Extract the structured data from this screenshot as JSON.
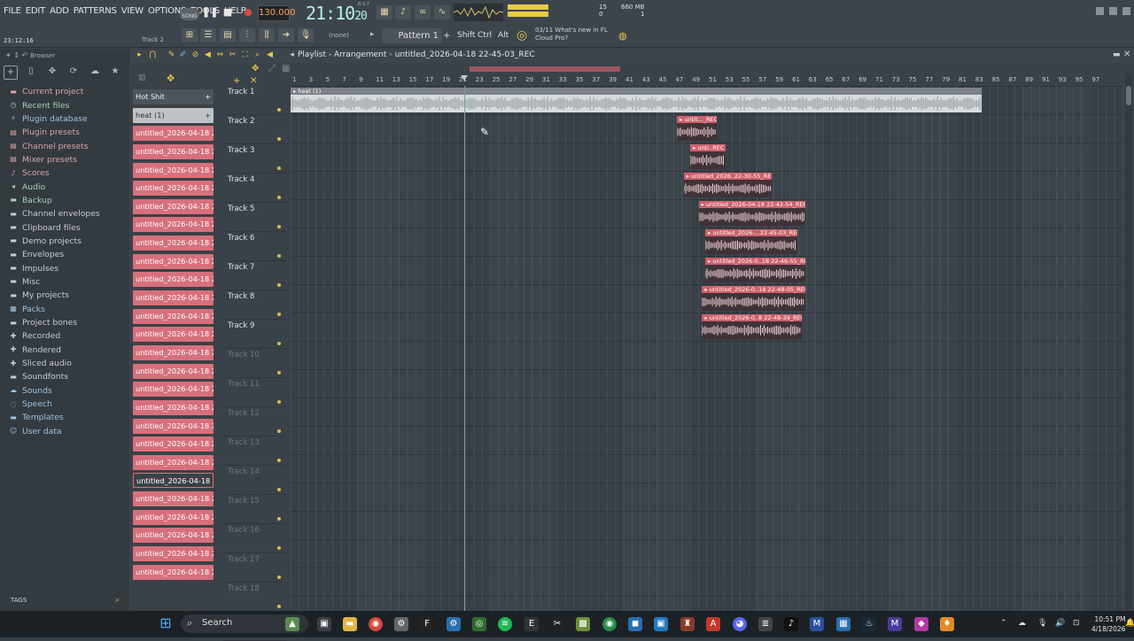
{
  "menu": [
    "FILE",
    "EDIT",
    "ADD",
    "PATTERNS",
    "VIEW",
    "OPTIONS",
    "TOOLS",
    "HELP"
  ],
  "transport": {
    "mode": "SONG",
    "tempo": "130.000",
    "clock": "21:10",
    "clock_small": "20",
    "clock_unit": "B:S:T"
  },
  "status": {
    "memory": "660 MB",
    "memory_sub": "1",
    "polyphony": "15",
    "polyphony_sub": "0"
  },
  "hint": {
    "time": "23:12:16",
    "track": "Track 2"
  },
  "pattern": {
    "none_label": "(none)",
    "pattern_label": "Pattern 1",
    "shift": "Shift",
    "ctrl": "Ctrl",
    "alt": "Alt"
  },
  "news": {
    "line1": "03/11  What's new in FL",
    "line2": "Cloud Pro?"
  },
  "browser": {
    "title": "Browser",
    "items": [
      {
        "label": "Current project",
        "color": "#d9a5aa",
        "icon": "folder-icon"
      },
      {
        "label": "Recent files",
        "color": "#a9d1b8",
        "icon": "clock-icon"
      },
      {
        "label": "Plugin database",
        "color": "#9fc3e0",
        "icon": "plug-icon"
      },
      {
        "label": "Plugin presets",
        "color": "#d9a5aa",
        "icon": "preset-icon"
      },
      {
        "label": "Channel presets",
        "color": "#d9a5aa",
        "icon": "preset-icon"
      },
      {
        "label": "Mixer presets",
        "color": "#d9a5aa",
        "icon": "preset-icon"
      },
      {
        "label": "Scores",
        "color": "#d9a5aa",
        "icon": "note-icon"
      },
      {
        "label": "Audio",
        "color": "#a9d1b8",
        "icon": "speaker-icon"
      },
      {
        "label": "Backup",
        "color": "#a9d1b8",
        "icon": "folder-icon"
      },
      {
        "label": "Channel envelopes",
        "color": "#c8ccd0",
        "icon": "folder-icon"
      },
      {
        "label": "Clipboard files",
        "color": "#c8ccd0",
        "icon": "folder-icon"
      },
      {
        "label": "Demo projects",
        "color": "#c8ccd0",
        "icon": "folder-icon"
      },
      {
        "label": "Envelopes",
        "color": "#c8ccd0",
        "icon": "folder-icon"
      },
      {
        "label": "Impulses",
        "color": "#c8ccd0",
        "icon": "folder-icon"
      },
      {
        "label": "Misc",
        "color": "#c8ccd0",
        "icon": "folder-icon"
      },
      {
        "label": "My projects",
        "color": "#c8ccd0",
        "icon": "folder-icon"
      },
      {
        "label": "Packs",
        "color": "#9fc3e0",
        "icon": "pack-icon"
      },
      {
        "label": "Project bones",
        "color": "#c8ccd0",
        "icon": "folder-icon"
      },
      {
        "label": "Recorded",
        "color": "#c8ccd0",
        "icon": "plus-icon"
      },
      {
        "label": "Rendered",
        "color": "#c8ccd0",
        "icon": "plus-icon"
      },
      {
        "label": "Sliced audio",
        "color": "#c8ccd0",
        "icon": "plus-icon"
      },
      {
        "label": "Soundfonts",
        "color": "#c8ccd0",
        "icon": "folder-icon"
      },
      {
        "label": "Sounds",
        "color": "#9fc3e0",
        "icon": "cloud-icon"
      },
      {
        "label": "Speech",
        "color": "#9fc3e0",
        "icon": "speech-icon"
      },
      {
        "label": "Templates",
        "color": "#9fc3e0",
        "icon": "folder-icon"
      },
      {
        "label": "User data",
        "color": "#9fc3e0",
        "icon": "user-icon"
      }
    ],
    "tags": "TAGS"
  },
  "picker": [
    {
      "label": "Hot Shit",
      "style": "dark"
    },
    {
      "label": "heat (1)",
      "style": "sel"
    },
    {
      "label": "untitled_2026-04-18 22-...",
      "style": "red"
    },
    {
      "label": "untitled_2026-04-18 22-...",
      "style": "red"
    },
    {
      "label": "untitled_2026-04-18 22-...",
      "style": "red"
    },
    {
      "label": "untitled_2026-04-18 22-...",
      "style": "red"
    },
    {
      "label": "untitled_2026-04-18 22-...",
      "style": "red"
    },
    {
      "label": "untitled_2026-04-18 22-...",
      "style": "red"
    },
    {
      "label": "untitled_2026-04-18 22-...",
      "style": "red"
    },
    {
      "label": "untitled_2026-04-18 22-...",
      "style": "red"
    },
    {
      "label": "untitled_2026-04-18 22-...",
      "style": "red"
    },
    {
      "label": "untitled_2026-04-18 22-...",
      "style": "red"
    },
    {
      "label": "untitled_2026-04-18 22-...",
      "style": "red"
    },
    {
      "label": "untitled_2026-04-18 22-...",
      "style": "red"
    },
    {
      "label": "untitled_2026-04-18 22-...",
      "style": "red"
    },
    {
      "label": "untitled_2026-04-18 22-...",
      "style": "red"
    },
    {
      "label": "untitled_2026-04-18 22-...",
      "style": "red"
    },
    {
      "label": "untitled_2026-04-18 22-...",
      "style": "red"
    },
    {
      "label": "untitled_2026-04-18 22-...",
      "style": "red"
    },
    {
      "label": "untitled_2026-04-18 22-...",
      "style": "red"
    },
    {
      "label": "untitled_2026-04-18 22-...",
      "style": "red"
    },
    {
      "label": "untitled_2026-04-18 22-...",
      "style": "outline"
    },
    {
      "label": "untitled_2026-04-18 22-...",
      "style": "red"
    },
    {
      "label": "untitled_2026-04-18 22-...",
      "style": "red"
    },
    {
      "label": "untitled_2026-04-18 22-...",
      "style": "red"
    },
    {
      "label": "untitled_2026-04-18 22-...",
      "style": "red"
    },
    {
      "label": "untitled_2026-04-18 22-...",
      "style": "red"
    }
  ],
  "playlist": {
    "title": "Playlist - Arrangement",
    "pattern_name": "untitled_2026-04-18 22-45-03_REC",
    "ruler": [
      "1",
      "3",
      "5",
      "7",
      "9",
      "11",
      "13",
      "15",
      "17",
      "19",
      "21",
      "23",
      "25",
      "27",
      "29",
      "31",
      "33",
      "35",
      "37",
      "39",
      "41",
      "43",
      "45",
      "47",
      "49",
      "51",
      "53",
      "55",
      "57",
      "59",
      "61",
      "63",
      "65",
      "67",
      "69",
      "71",
      "73",
      "75",
      "77",
      "79",
      "81",
      "83",
      "85",
      "87",
      "89",
      "91",
      "93",
      "95",
      "97"
    ],
    "tracks": [
      "Track 1",
      "Track 2",
      "Track 3",
      "Track 4",
      "Track 5",
      "Track 6",
      "Track 7",
      "Track 8",
      "Track 9",
      "Track 10",
      "Track 11",
      "Track 12",
      "Track 13",
      "Track 14",
      "Track 15",
      "Track 16",
      "Track 17",
      "Track 18",
      "Track 19"
    ],
    "active_tracks": 9,
    "clips": [
      {
        "track": 1,
        "start_bar": 1,
        "end_bar": 42.5,
        "label": "heat (1)",
        "style": "grey"
      },
      {
        "track": 2,
        "start_bar": 24.2,
        "end_bar": 26.6,
        "label": "untit..._REC",
        "style": "red"
      },
      {
        "track": 3,
        "start_bar": 25.0,
        "end_bar": 27.1,
        "label": "unti..REC",
        "style": "red"
      },
      {
        "track": 4,
        "start_bar": 24.6,
        "end_bar": 29.9,
        "label": "untitled_2026..22-30-55_REC",
        "style": "red"
      },
      {
        "track": 5,
        "start_bar": 25.5,
        "end_bar": 31.9,
        "label": "untitled_2026-04-18 22-42-54_REC",
        "style": "red"
      },
      {
        "track": 6,
        "start_bar": 25.9,
        "end_bar": 31.4,
        "label": "untitled_2026-...22-45-03_REC",
        "style": "red"
      },
      {
        "track": 7,
        "start_bar": 25.9,
        "end_bar": 31.9,
        "label": "untitled_2026-0..18 22-46-55_REC",
        "style": "red"
      },
      {
        "track": 8,
        "start_bar": 25.7,
        "end_bar": 31.9,
        "label": "untitled_2026-0..18 22-48-05_REC",
        "style": "red"
      },
      {
        "track": 9,
        "start_bar": 25.7,
        "end_bar": 31.7,
        "label": "untitled_2026-0..8 22-48-39_REC",
        "style": "red"
      }
    ],
    "playhead_bar": 11.4
  },
  "taskbar": {
    "search": "Search",
    "time": "10:51 PM",
    "date": "4/18/2026"
  }
}
